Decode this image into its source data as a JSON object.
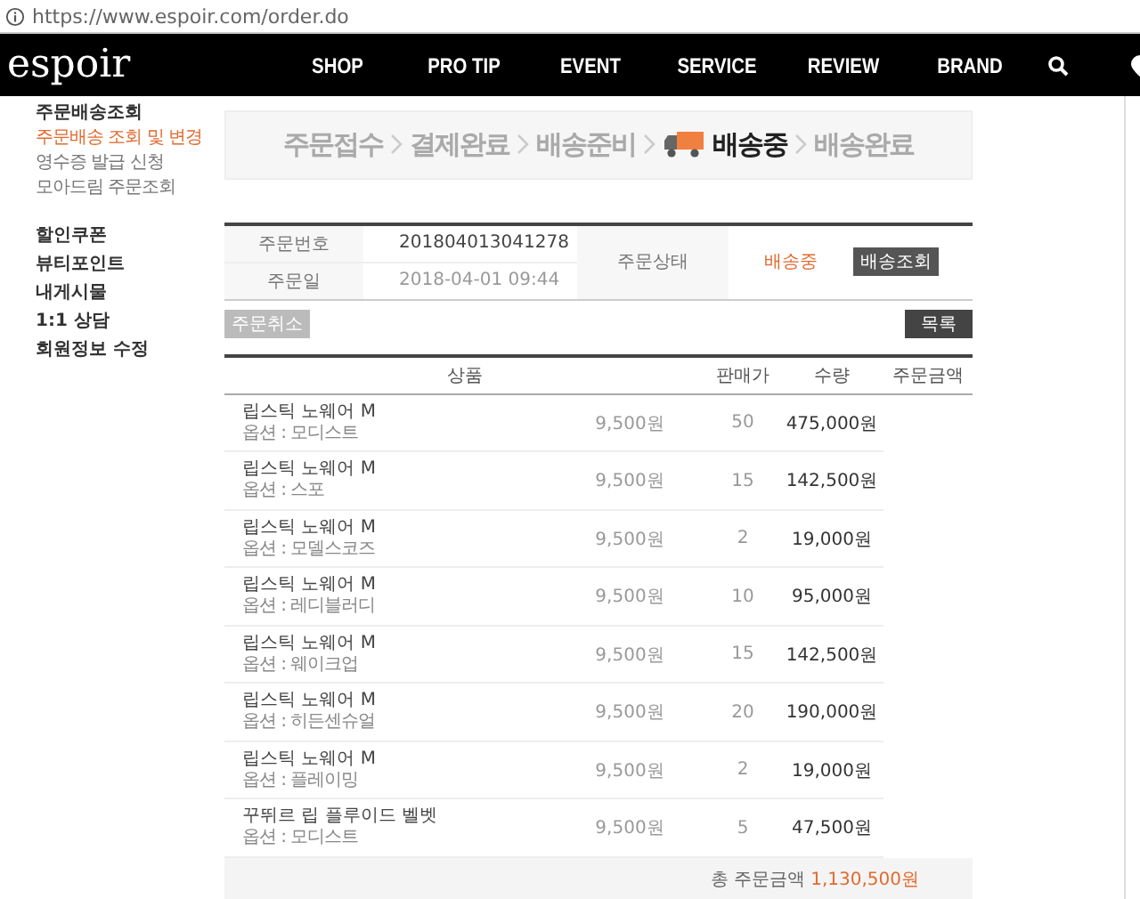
{
  "address_bar": {
    "url": "https://www.espoir.com/order.do"
  },
  "nav": {
    "logo": "espoir",
    "items": [
      "SHOP",
      "PRO TIP",
      "EVENT",
      "SERVICE",
      "REVIEW",
      "BRAND"
    ]
  },
  "sidebar": {
    "group": {
      "title": "주문배송조회",
      "items": [
        {
          "label": "주문배송 조회 및 변경",
          "selected": true
        },
        {
          "label": "영수증 발급 신청",
          "selected": false
        },
        {
          "label": "모아드림 주문조회",
          "selected": false
        }
      ]
    },
    "links": [
      "할인쿠폰",
      "뷰티포인트",
      "내게시물",
      "1:1 상담",
      "회원정보 수정"
    ]
  },
  "progress": {
    "steps": [
      {
        "label": "주문접수",
        "selected": false
      },
      {
        "label": "결제완료",
        "selected": false
      },
      {
        "label": "배송준비",
        "selected": false
      },
      {
        "label": "배송중",
        "selected": true
      },
      {
        "label": "배송완료",
        "selected": false
      }
    ]
  },
  "order_info": {
    "number_label": "주문번호",
    "number": "201804013041278",
    "date_label": "주문일",
    "date": "2018-04-01 09:44",
    "status_label": "주문상태",
    "status": "배송중",
    "track_button": "배송조회"
  },
  "cancel_button": "주문취소",
  "list_button": "목록",
  "items_table": {
    "columns": [
      "상품",
      "판매가",
      "수량",
      "주문금액"
    ],
    "rows": [
      {
        "name": "립스틱 노웨어 M",
        "option": "옵션 : 모디스트",
        "price": "9,500원",
        "quantity": "50",
        "amount": "475,000원"
      },
      {
        "name": "립스틱 노웨어 M",
        "option": "옵션 : 스포",
        "price": "9,500원",
        "quantity": "15",
        "amount": "142,500원"
      },
      {
        "name": "립스틱 노웨어 M",
        "option": "옵션 : 모델스코즈",
        "price": "9,500원",
        "quantity": "2",
        "amount": "19,000원"
      },
      {
        "name": "립스틱 노웨어 M",
        "option": "옵션 : 레디블러디",
        "price": "9,500원",
        "quantity": "10",
        "amount": "95,000원"
      },
      {
        "name": "립스틱 노웨어 M",
        "option": "옵션 : 웨이크업",
        "price": "9,500원",
        "quantity": "15",
        "amount": "142,500원"
      },
      {
        "name": "립스틱 노웨어 M",
        "option": "옵션 : 히든센슈얼",
        "price": "9,500원",
        "quantity": "20",
        "amount": "190,000원"
      },
      {
        "name": "립스틱 노웨어 M",
        "option": "옵션 : 플레이밍",
        "price": "9,500원",
        "quantity": "2",
        "amount": "19,000원"
      },
      {
        "name": "꾸뛰르 립 플루이드 벨벳",
        "option": "옵션 : 모디스트",
        "price": "9,500원",
        "quantity": "5",
        "amount": "47,500원"
      }
    ],
    "total_label": "총 주문금액",
    "total_value": "1,130,500원"
  }
}
